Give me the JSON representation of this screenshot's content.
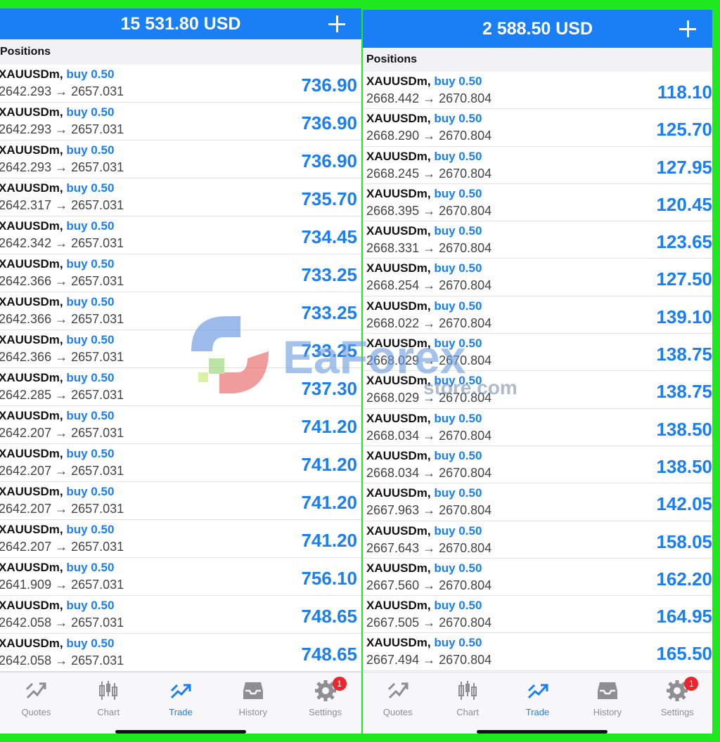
{
  "left": {
    "balance": "15 531.80 USD",
    "section_title": "Positions",
    "positions": [
      {
        "symbol": "XAUUSDm",
        "direction": "buy 0.50",
        "prices": "2642.293 → 2657.031",
        "profit": "736.90"
      },
      {
        "symbol": "XAUUSDm",
        "direction": "buy 0.50",
        "prices": "2642.293 → 2657.031",
        "profit": "736.90"
      },
      {
        "symbol": "XAUUSDm",
        "direction": "buy 0.50",
        "prices": "2642.293 → 2657.031",
        "profit": "736.90"
      },
      {
        "symbol": "XAUUSDm",
        "direction": "buy 0.50",
        "prices": "2642.317 → 2657.031",
        "profit": "735.70"
      },
      {
        "symbol": "XAUUSDm",
        "direction": "buy 0.50",
        "prices": "2642.342 → 2657.031",
        "profit": "734.45"
      },
      {
        "symbol": "XAUUSDm",
        "direction": "buy 0.50",
        "prices": "2642.366 → 2657.031",
        "profit": "733.25"
      },
      {
        "symbol": "XAUUSDm",
        "direction": "buy 0.50",
        "prices": "2642.366 → 2657.031",
        "profit": "733.25"
      },
      {
        "symbol": "XAUUSDm",
        "direction": "buy 0.50",
        "prices": "2642.366 → 2657.031",
        "profit": "733.25"
      },
      {
        "symbol": "XAUUSDm",
        "direction": "buy 0.50",
        "prices": "2642.285 → 2657.031",
        "profit": "737.30"
      },
      {
        "symbol": "XAUUSDm",
        "direction": "buy 0.50",
        "prices": "2642.207 → 2657.031",
        "profit": "741.20"
      },
      {
        "symbol": "XAUUSDm",
        "direction": "buy 0.50",
        "prices": "2642.207 → 2657.031",
        "profit": "741.20"
      },
      {
        "symbol": "XAUUSDm",
        "direction": "buy 0.50",
        "prices": "2642.207 → 2657.031",
        "profit": "741.20"
      },
      {
        "symbol": "XAUUSDm",
        "direction": "buy 0.50",
        "prices": "2642.207 → 2657.031",
        "profit": "741.20"
      },
      {
        "symbol": "XAUUSDm",
        "direction": "buy 0.50",
        "prices": "2641.909 → 2657.031",
        "profit": "756.10"
      },
      {
        "symbol": "XAUUSDm",
        "direction": "buy 0.50",
        "prices": "2642.058 → 2657.031",
        "profit": "748.65"
      },
      {
        "symbol": "XAUUSDm",
        "direction": "buy 0.50",
        "prices": "2642.058 → 2657.031",
        "profit": "748.65"
      }
    ]
  },
  "right": {
    "balance": "2 588.50 USD",
    "section_title": "Positions",
    "positions": [
      {
        "symbol": "XAUUSDm",
        "direction": "buy 0.50",
        "prices": "2668.442 → 2670.804",
        "profit": "118.10"
      },
      {
        "symbol": "XAUUSDm",
        "direction": "buy 0.50",
        "prices": "2668.290 → 2670.804",
        "profit": "125.70"
      },
      {
        "symbol": "XAUUSDm",
        "direction": "buy 0.50",
        "prices": "2668.245 → 2670.804",
        "profit": "127.95"
      },
      {
        "symbol": "XAUUSDm",
        "direction": "buy 0.50",
        "prices": "2668.395 → 2670.804",
        "profit": "120.45"
      },
      {
        "symbol": "XAUUSDm",
        "direction": "buy 0.50",
        "prices": "2668.331 → 2670.804",
        "profit": "123.65"
      },
      {
        "symbol": "XAUUSDm",
        "direction": "buy 0.50",
        "prices": "2668.254 → 2670.804",
        "profit": "127.50"
      },
      {
        "symbol": "XAUUSDm",
        "direction": "buy 0.50",
        "prices": "2668.022 → 2670.804",
        "profit": "139.10"
      },
      {
        "symbol": "XAUUSDm",
        "direction": "buy 0.50",
        "prices": "2668.029 → 2670.804",
        "profit": "138.75"
      },
      {
        "symbol": "XAUUSDm",
        "direction": "buy 0.50",
        "prices": "2668.029 → 2670.804",
        "profit": "138.75"
      },
      {
        "symbol": "XAUUSDm",
        "direction": "buy 0.50",
        "prices": "2668.034 → 2670.804",
        "profit": "138.50"
      },
      {
        "symbol": "XAUUSDm",
        "direction": "buy 0.50",
        "prices": "2668.034 → 2670.804",
        "profit": "138.50"
      },
      {
        "symbol": "XAUUSDm",
        "direction": "buy 0.50",
        "prices": "2667.963 → 2670.804",
        "profit": "142.05"
      },
      {
        "symbol": "XAUUSDm",
        "direction": "buy 0.50",
        "prices": "2667.643 → 2670.804",
        "profit": "158.05"
      },
      {
        "symbol": "XAUUSDm",
        "direction": "buy 0.50",
        "prices": "2667.560 → 2670.804",
        "profit": "162.20"
      },
      {
        "symbol": "XAUUSDm",
        "direction": "buy 0.50",
        "prices": "2667.505 → 2670.804",
        "profit": "164.95"
      },
      {
        "symbol": "XAUUSDm",
        "direction": "buy 0.50",
        "prices": "2667.494 → 2670.804",
        "profit": "165.50"
      }
    ]
  },
  "tabs": [
    {
      "label": "Quotes",
      "icon": "quotes-icon",
      "active": false
    },
    {
      "label": "Chart",
      "icon": "candlestick-chart-icon",
      "active": false
    },
    {
      "label": "Trade",
      "icon": "trade-icon",
      "active": true
    },
    {
      "label": "History",
      "icon": "history-inbox-icon",
      "active": false
    },
    {
      "label": "Settings",
      "icon": "gear-icon",
      "active": false,
      "badge": "1"
    }
  ],
  "watermark": {
    "text": "EaForex",
    "subtext": "store.com"
  },
  "colors": {
    "accent": "#1a7ef5",
    "frame": "#1ee81e",
    "badge": "#e8262b"
  }
}
